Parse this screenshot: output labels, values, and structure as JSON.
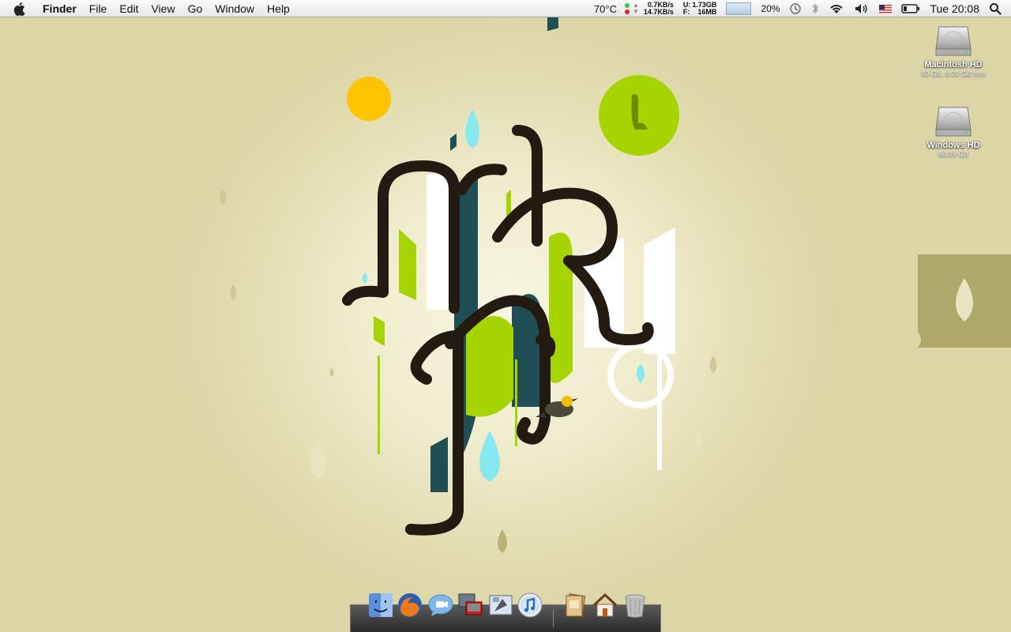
{
  "menubar": {
    "app_name": "Finder",
    "menus": [
      "File",
      "Edit",
      "View",
      "Go",
      "Window",
      "Help"
    ],
    "status": {
      "temperature": "70°C",
      "net_up": "0.7KB/s",
      "net_down": "14.7KB/s",
      "disk_u_label": "U:",
      "disk_f_label": "F:",
      "disk_u": "1.73GB",
      "disk_f": "16MB",
      "battery_percent": "20%",
      "clock": "Tue 20:08"
    }
  },
  "desktop": {
    "icons": [
      {
        "label": "Macintosh HD",
        "sub": "60 GB, 6.09 GB free"
      },
      {
        "label": "Windows HD",
        "sub": "60.99 GB"
      }
    ]
  },
  "dock": {
    "items": [
      "finder-icon",
      "firefox-icon",
      "ichat-icon",
      "parallels-icon",
      "mail-icon",
      "itunes-icon",
      "documents-stack-icon",
      "home-folder-icon",
      "trash-icon"
    ]
  },
  "colors": {
    "wallpaper_bg": "#e2dcb0",
    "ink": "#231a12",
    "lime": "#a6d400",
    "teal": "#1f4f55",
    "cyan": "#88e8f0",
    "yellow": "#ffc400",
    "olive_tab": "#b0a86a"
  }
}
